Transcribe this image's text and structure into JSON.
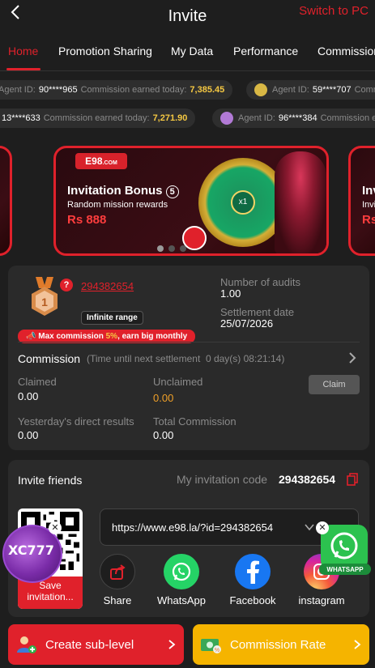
{
  "header": {
    "title": "Invite",
    "switch_label": "Switch to PC"
  },
  "tabs": [
    "Home",
    "Promotion Sharing",
    "My Data",
    "Performance",
    "Commission"
  ],
  "ticker": {
    "row1": [
      {
        "label": "Agent ID:",
        "id": "90****965",
        "earned_label": "Commission earned today:",
        "amount": "7,385.45"
      },
      {
        "label": "Agent ID:",
        "id": "59****707",
        "earned_label": "Comm"
      }
    ],
    "row2": [
      {
        "id": "13****633",
        "earned_label": "Commission earned today:",
        "amount": "7,271.90"
      },
      {
        "label": "Agent ID:",
        "id": "96****384",
        "earned_label": "Commission e"
      }
    ]
  },
  "banner": {
    "logo": "E98",
    "logo_suffix": ".COM",
    "title": "Invitation Bonus",
    "badge": "5",
    "subtitle": "Random mission rewards",
    "amount": "Rs 888",
    "wheel_center": "x1",
    "side_title": "Inv",
    "side_sub": "Invi",
    "side_amt": "Rs"
  },
  "agent": {
    "rank": "1",
    "id": "294382654",
    "range_label": "Infinite range",
    "max_commission_pre": "Max commission",
    "max_commission_pct": "5%",
    "max_commission_post": ", earn big monthly",
    "audits_label": "Number of audits",
    "audits_value": "1.00",
    "settlement_label": "Settlement date",
    "settlement_value": "25/07/2026"
  },
  "commission": {
    "title": "Commission",
    "time_note": "(Time until next settlement",
    "time_value": "0 day(s) 08:21:14)",
    "claimed_label": "Claimed",
    "claimed_value": "0.00",
    "unclaimed_label": "Unclaimed",
    "unclaimed_value": "0.00",
    "claim_button": "Claim",
    "yesterday_label": "Yesterday's direct results",
    "yesterday_value": "0.00",
    "total_label": "Total Commission",
    "total_value": "0.00"
  },
  "invite": {
    "title": "Invite friends",
    "code_label": "My invitation code",
    "code_value": "294382654",
    "save_label": "Save invitation...",
    "url": "https://www.e98.la/?id=294382654",
    "share": [
      {
        "label": "Share",
        "icon": "share-icon"
      },
      {
        "label": "WhatsApp",
        "icon": "whatsapp-icon"
      },
      {
        "label": "Facebook",
        "icon": "facebook-icon"
      },
      {
        "label": "instagram",
        "icon": "instagram-icon"
      }
    ]
  },
  "floating": {
    "xc_label": "XC777",
    "wa_label": "WHATSAPP"
  },
  "bottom": {
    "create_label": "Create sub-level",
    "rate_label": "Commission Rate"
  },
  "colors": {
    "accent": "#e0212b",
    "gold": "#f5b400",
    "bg": "#1e1e1e",
    "card": "#2a2a2a"
  }
}
